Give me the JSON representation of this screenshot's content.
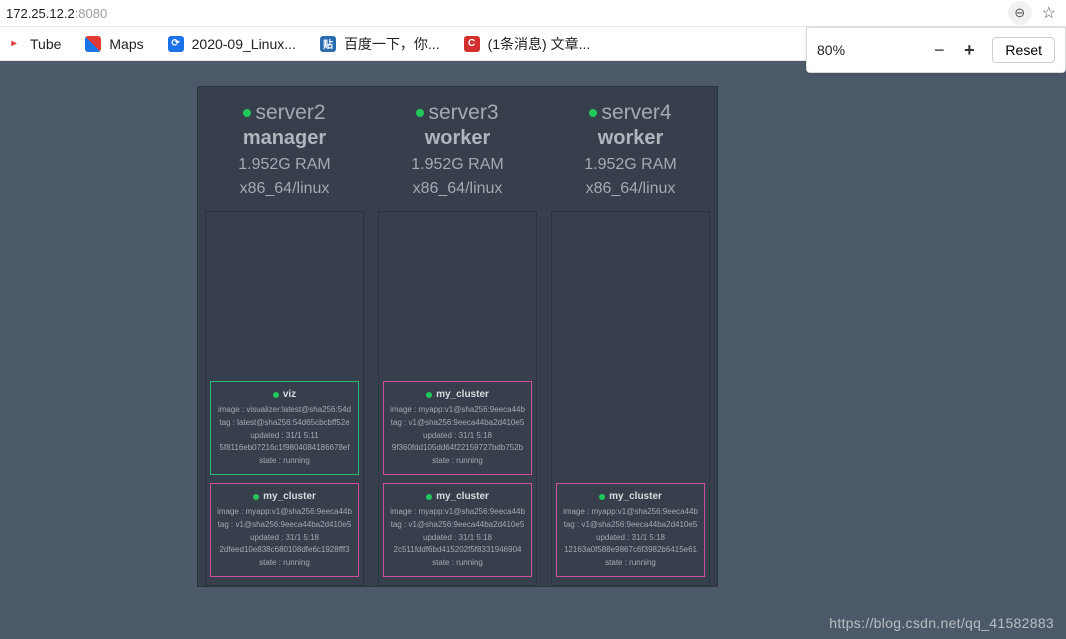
{
  "address": {
    "host": "172.25.12.2",
    "port": ":8080"
  },
  "zoom": {
    "pct": "80%",
    "reset": "Reset"
  },
  "bookmarks": [
    {
      "label": "Tube"
    },
    {
      "label": "Maps"
    },
    {
      "label": "2020-09_Linux..."
    },
    {
      "label": "百度一下，你..."
    },
    {
      "label": "(1条消息) 文章..."
    }
  ],
  "nodes": [
    {
      "name": "server2",
      "role": "manager",
      "ram": "1.952G RAM",
      "arch": "x86_64/linux"
    },
    {
      "name": "server3",
      "role": "worker",
      "ram": "1.952G RAM",
      "arch": "x86_64/linux"
    },
    {
      "name": "server4",
      "role": "worker",
      "ram": "1.952G RAM",
      "arch": "x86_64/linux"
    }
  ],
  "tasks": {
    "server2": [
      {
        "name": "viz",
        "border": "green",
        "lines": [
          "image : visualizer:latest@sha256:54d",
          "tag : latest@sha256:54d65cbcbff52e",
          "updated : 31/1 5:11",
          "5f8116eb07216c1f9804084186678ef",
          "state : running"
        ]
      },
      {
        "name": "my_cluster",
        "border": "pink",
        "lines": [
          "image : myapp:v1@sha256:9eeca44b",
          "tag : v1@sha256:9eeca44ba2d410e5",
          "updated : 31/1 5:18",
          "2dfeed10e838c680108dfe6c1928fff3",
          "state : running"
        ]
      }
    ],
    "server3": [
      {
        "name": "my_cluster",
        "border": "pink",
        "lines": [
          "image : myapp:v1@sha256:9eeca44b",
          "tag : v1@sha256:9eeca44ba2d410e5",
          "updated : 31/1 5:18",
          "9f360fdd105dd64f22159727bdb752b",
          "state : running"
        ]
      },
      {
        "name": "my_cluster",
        "border": "pink",
        "lines": [
          "image : myapp:v1@sha256:9eeca44b",
          "tag : v1@sha256:9eeca44ba2d410e5",
          "updated : 31/1 5:18",
          "2c511fddf6bd415202f5f8331946904",
          "state : running"
        ]
      }
    ],
    "server4": [
      {
        "name": "my_cluster",
        "border": "pink",
        "lines": [
          "image : myapp:v1@sha256:9eeca44b",
          "tag : v1@sha256:9eeca44ba2d410e5",
          "updated : 31/1 5:18",
          "12163a0f588e9867c6f3982b6415e61",
          "state : running"
        ]
      }
    ]
  },
  "watermark": "https://blog.csdn.net/qq_41582883",
  "icons": {
    "zoom_out": "−",
    "zoom_in": "+",
    "star": "☆",
    "magnify": "⊖"
  }
}
